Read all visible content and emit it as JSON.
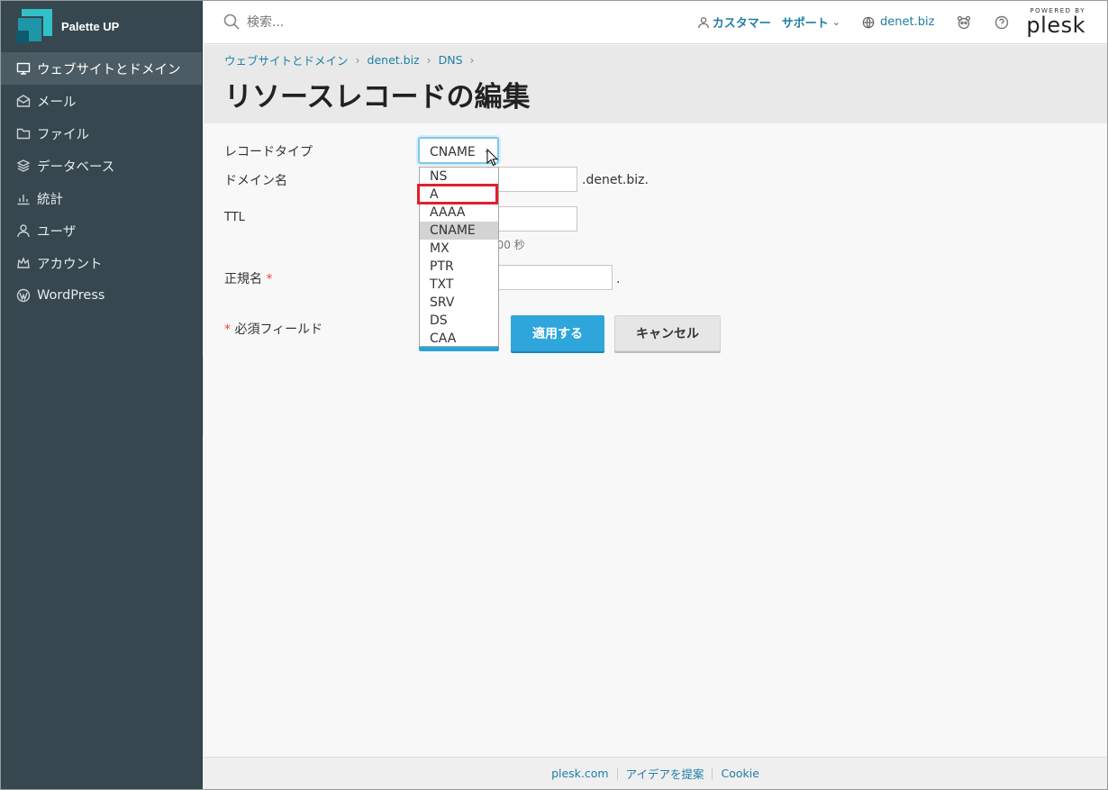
{
  "brand": {
    "name": "Palette UP"
  },
  "sidebar": {
    "items": [
      {
        "label": "ウェブサイトとドメイン",
        "icon": "monitor-icon",
        "active": true
      },
      {
        "label": "メール",
        "icon": "mail-icon"
      },
      {
        "label": "ファイル",
        "icon": "folder-icon"
      },
      {
        "label": "データベース",
        "icon": "database-icon"
      },
      {
        "label": "統計",
        "icon": "stats-icon"
      },
      {
        "label": "ユーザ",
        "icon": "user-icon"
      },
      {
        "label": "アカウント",
        "icon": "crown-icon"
      },
      {
        "label": "WordPress",
        "icon": "wordpress-icon"
      }
    ],
    "collapse_glyph": "‹"
  },
  "topbar": {
    "search_placeholder": "検索...",
    "customer_label": "カスタマー",
    "support_label": "サポート",
    "support_caret": "⌄",
    "domain_label": "denet.biz",
    "logo_small": "POWERED BY",
    "logo_big": "plesk"
  },
  "breadcrumb": {
    "items": [
      "ウェブサイトとドメイン",
      "denet.biz",
      "DNS"
    ],
    "separator": "›"
  },
  "page": {
    "title": "リソースレコードの編集"
  },
  "form": {
    "record_type_label": "レコードタイプ",
    "record_type_value": "CNAME",
    "caret": "⌄",
    "domain_label": "ドメイン名",
    "domain_suffix": ".denet.biz.",
    "ttl_label": "TTL",
    "ttl_hint_visible": "600 秒",
    "canonical_label": "正規名",
    "canonical_suffix": ".",
    "required_mark": "*",
    "required_note": "必須フィールド"
  },
  "dropdown": {
    "options": [
      "NS",
      "A",
      "AAAA",
      "CNAME",
      "MX",
      "PTR",
      "TXT",
      "SRV",
      "DS",
      "CAA"
    ],
    "selected_index": 3,
    "highlighted_index": 1,
    "highlight_color": "#e0202b"
  },
  "buttons": {
    "apply": "適用する",
    "cancel": "キャンセル"
  },
  "footer": {
    "links": [
      "plesk.com",
      "アイデアを提案",
      "Cookie"
    ]
  },
  "colors": {
    "sidebar_bg": "#36474f",
    "accent": "#2ea6dc",
    "link": "#1f7ea6"
  }
}
